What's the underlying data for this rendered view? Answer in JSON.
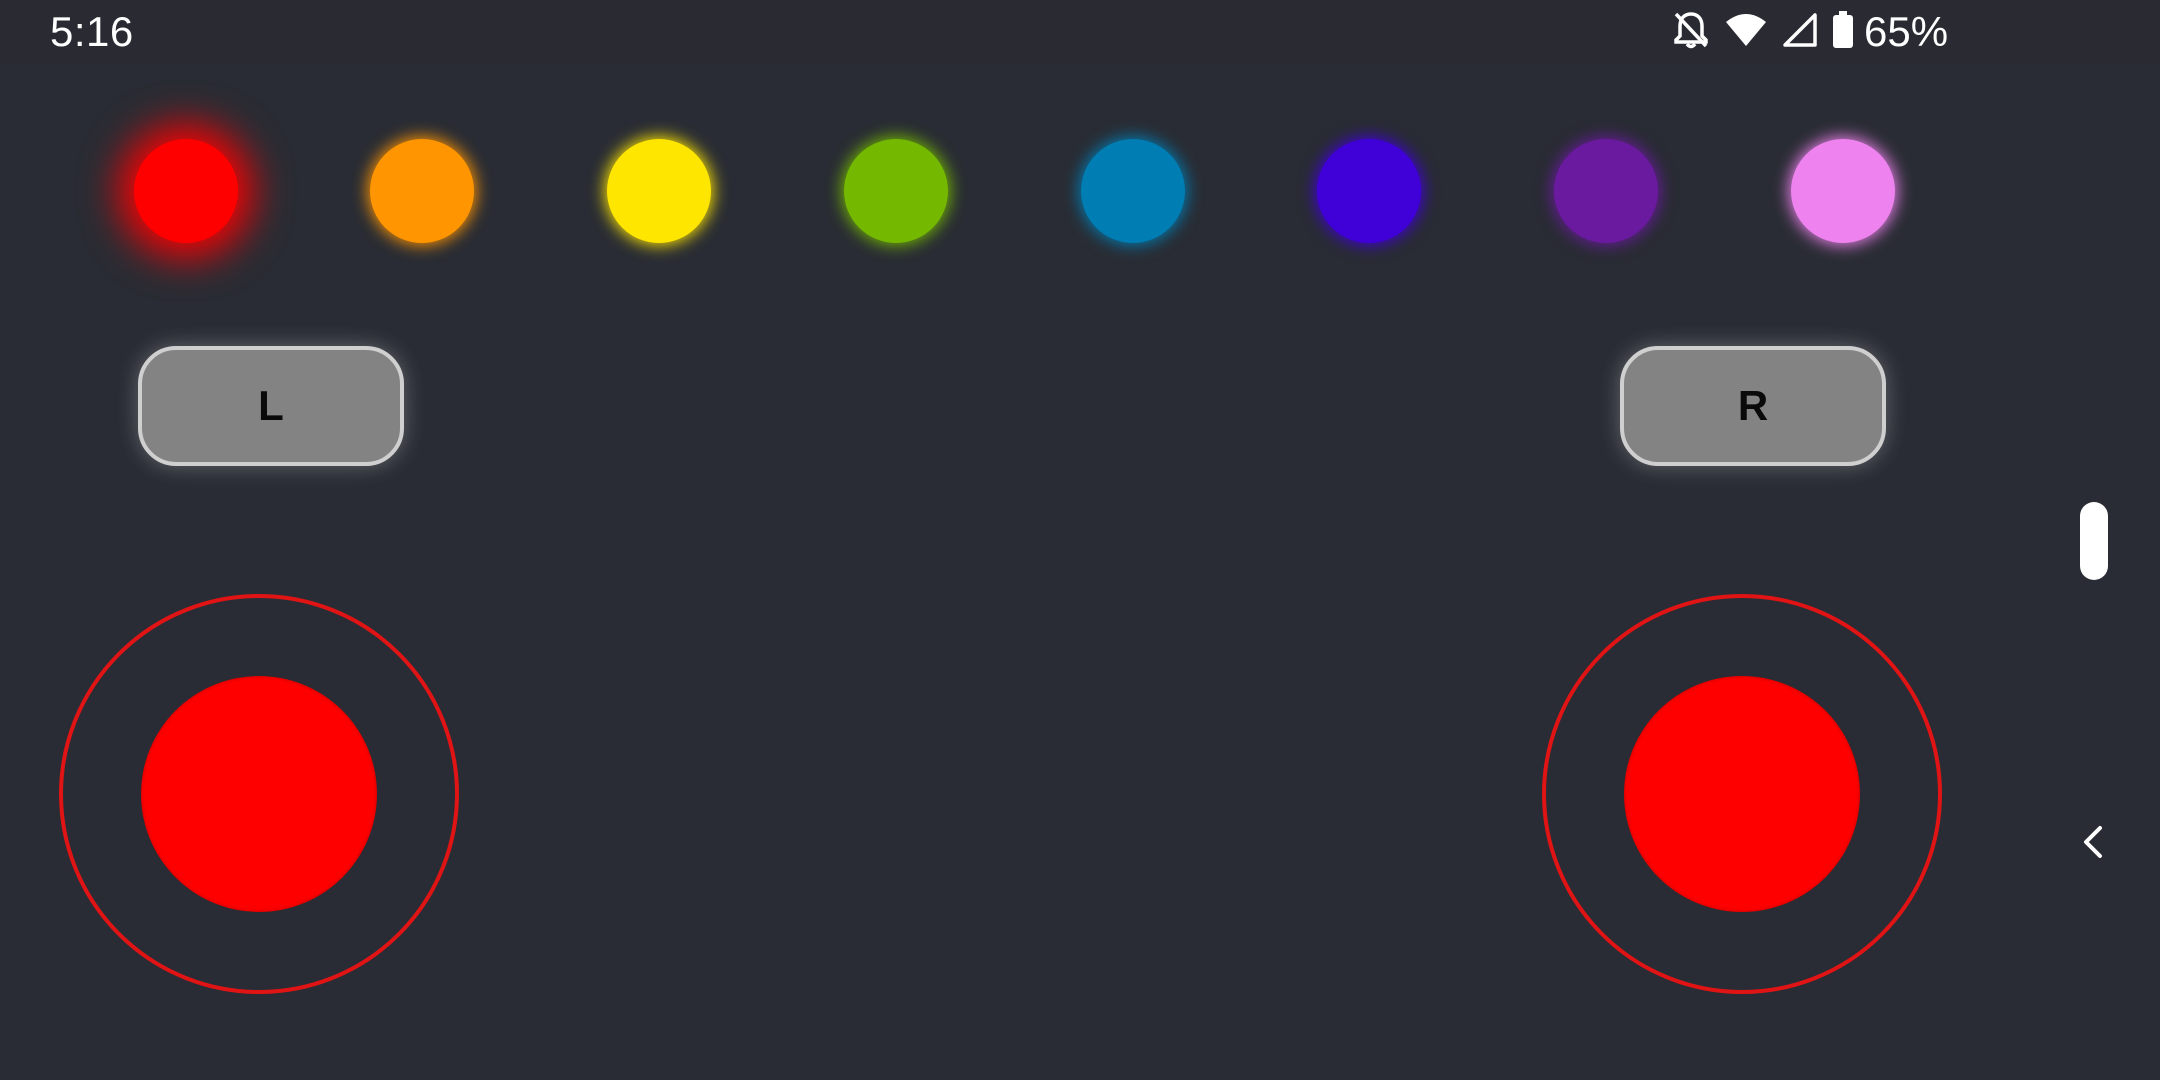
{
  "status_bar": {
    "time": "5:16",
    "battery_percent": "65%",
    "icons": [
      "notifications-off-icon",
      "wifi-icon",
      "cell-signal-icon",
      "battery-icon"
    ]
  },
  "color_palette": [
    {
      "name": "red",
      "color": "#ff0000",
      "selected": true
    },
    {
      "name": "orange",
      "color": "#ff9500",
      "selected": false
    },
    {
      "name": "yellow",
      "color": "#ffe600",
      "selected": false
    },
    {
      "name": "green",
      "color": "#74b800",
      "selected": false
    },
    {
      "name": "blue",
      "color": "#007db3",
      "selected": false
    },
    {
      "name": "indigo",
      "color": "#4000d8",
      "selected": false
    },
    {
      "name": "purple",
      "color": "#6a1a9e",
      "selected": false
    },
    {
      "name": "pink",
      "color": "#ee82ee",
      "selected": false
    }
  ],
  "buttons": {
    "left_label": "L",
    "right_label": "R"
  },
  "joysticks": {
    "color": "#ff0000",
    "ring_color": "#e01414"
  },
  "navigation": {
    "icons": [
      "side-handle",
      "back-chevron-icon"
    ]
  }
}
